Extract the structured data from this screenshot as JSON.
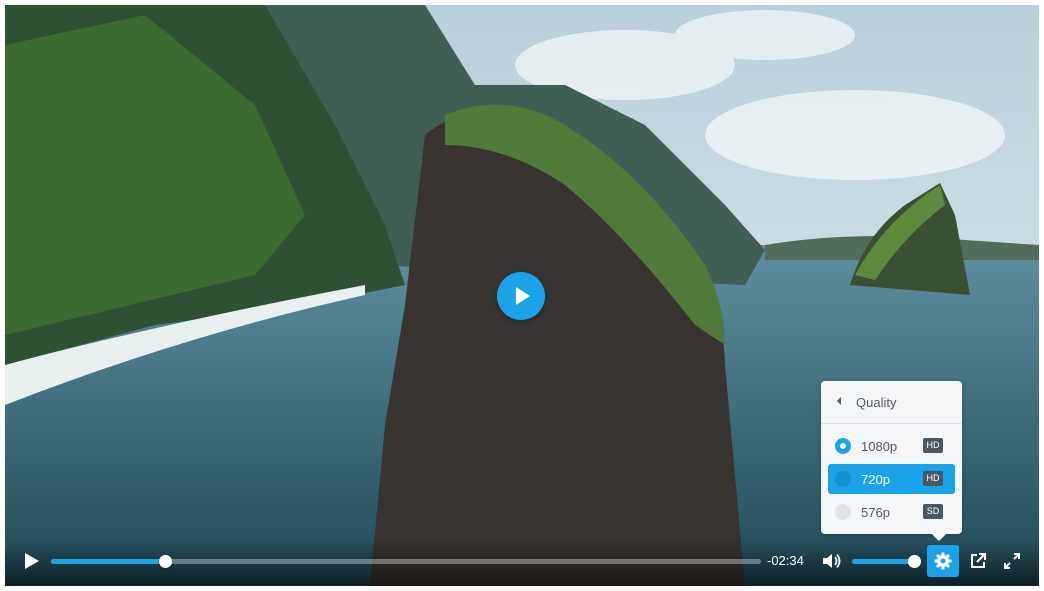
{
  "player": {
    "big_play_icon": "play-icon",
    "time_remaining": "-02:34",
    "progress": 0.16,
    "volume": 1.0,
    "icons": [
      "play-icon",
      "volume-icon",
      "gear-icon",
      "external-link-icon",
      "fullscreen-icon"
    ]
  },
  "quality_menu": {
    "title": "Quality",
    "options": [
      {
        "label": "1080p",
        "badge": "HD",
        "selected": true
      },
      {
        "label": "720p",
        "badge": "HD",
        "highlighted": true
      },
      {
        "label": "576p",
        "badge": "SD"
      }
    ]
  },
  "colors": {
    "accent": "#1aa3e8",
    "menu_bg": "#f5f6f8",
    "badge_bg": "#4a5764"
  }
}
